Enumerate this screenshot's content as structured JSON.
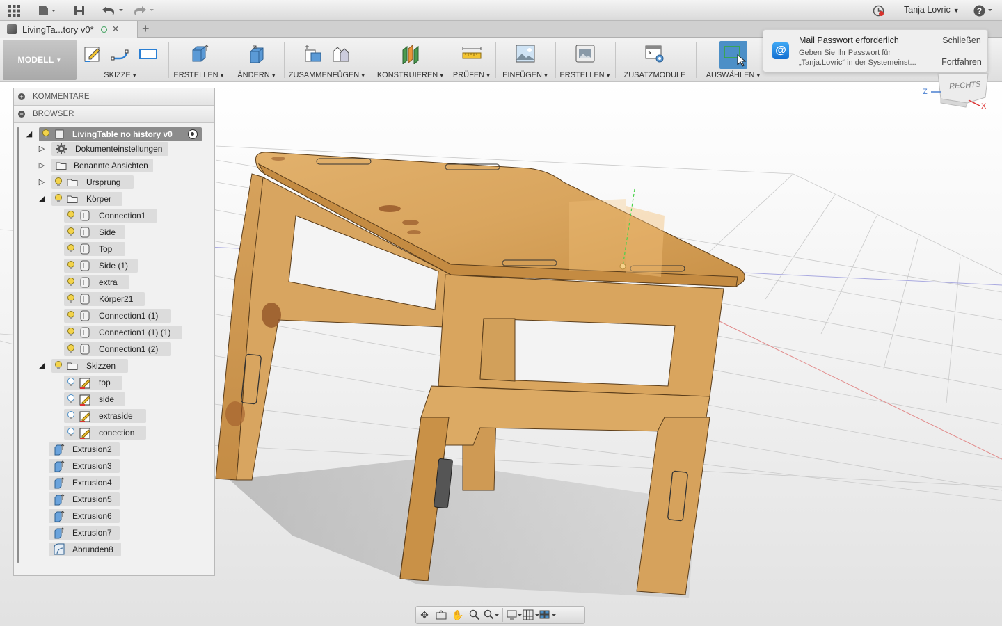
{
  "appbar": {
    "user_name": "Tanja Lovric",
    "icons": [
      "apps-grid-icon",
      "file-menu-icon",
      "save-icon",
      "undo-icon",
      "redo-icon",
      "job-status-icon",
      "help-icon"
    ]
  },
  "tabs": {
    "document_title": "LivingTa...tory v0*",
    "close": "✕",
    "new_tab": "+"
  },
  "toolbar": {
    "workspace": "MODELL",
    "groups": [
      {
        "label": "SKIZZE"
      },
      {
        "label": "ERSTELLEN"
      },
      {
        "label": "ÄNDERN"
      },
      {
        "label": "ZUSAMMENFÜGEN"
      },
      {
        "label": "KONSTRUIEREN"
      },
      {
        "label": "PRÜFEN"
      },
      {
        "label": "EINFÜGEN"
      },
      {
        "label": "ERSTELLEN"
      },
      {
        "label": "ZUSATZMODULE"
      },
      {
        "label": "AUSWÄHLEN"
      }
    ]
  },
  "notification": {
    "title": "Mail Passwort erforderlich",
    "body": "Geben Sie Ihr Passwort für „Tanja.Lovric“ in der Systemeinst...",
    "close_button": "Schließen",
    "continue_button": "Fortfahren",
    "app_icon": "@"
  },
  "viewcube": {
    "face": "RECHTS",
    "axis_z": "Z",
    "axis_x": "X"
  },
  "browser": {
    "comments_header": "KOMMENTARE",
    "browser_header": "BROWSER",
    "root": "LivingTable no history v0",
    "items": [
      {
        "label": "Dokumenteinstellungen"
      },
      {
        "label": "Benannte Ansichten"
      },
      {
        "label": "Ursprung"
      },
      {
        "label": "Körper"
      },
      {
        "label": "Connection1"
      },
      {
        "label": "Side"
      },
      {
        "label": "Top"
      },
      {
        "label": "Side (1)"
      },
      {
        "label": "extra"
      },
      {
        "label": "Körper21"
      },
      {
        "label": "Connection1 (1)"
      },
      {
        "label": "Connection1 (1) (1)"
      },
      {
        "label": "Connection1 (2)"
      },
      {
        "label": "Skizzen"
      },
      {
        "label": "top"
      },
      {
        "label": "side"
      },
      {
        "label": "extraside"
      },
      {
        "label": "conection"
      },
      {
        "label": "Extrusion2"
      },
      {
        "label": "Extrusion3"
      },
      {
        "label": "Extrusion4"
      },
      {
        "label": "Extrusion5"
      },
      {
        "label": "Extrusion6"
      },
      {
        "label": "Extrusion7"
      },
      {
        "label": "Abrunden8"
      }
    ]
  },
  "colors": {
    "wood": "#d9a55e",
    "wood_dark": "#b67d3b",
    "accent_select": "#4c8fc7"
  }
}
